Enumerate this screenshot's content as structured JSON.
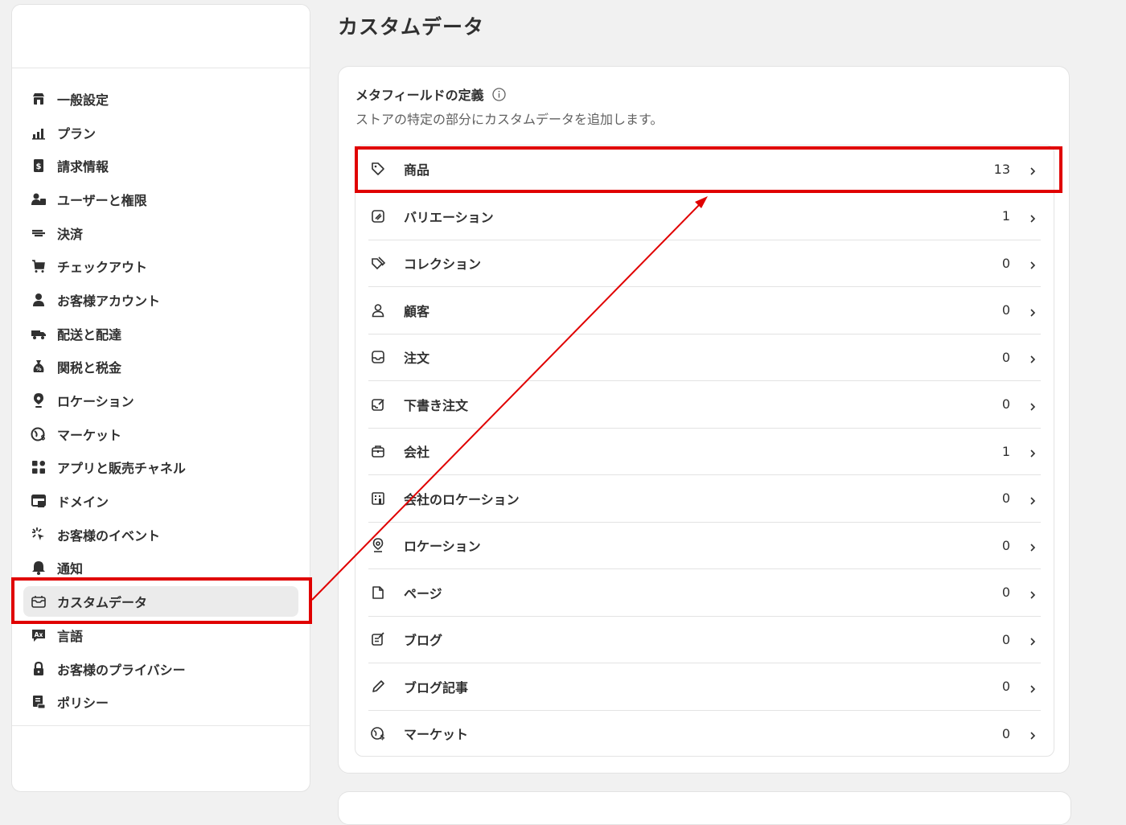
{
  "page": {
    "title": "カスタムデータ"
  },
  "sidebar": {
    "items": [
      {
        "label": "一般設定",
        "icon": "store-icon"
      },
      {
        "label": "プラン",
        "icon": "plan-chart-icon"
      },
      {
        "label": "請求情報",
        "icon": "billing-icon"
      },
      {
        "label": "ユーザーと権限",
        "icon": "users-icon"
      },
      {
        "label": "決済",
        "icon": "payments-icon"
      },
      {
        "label": "チェックアウト",
        "icon": "cart-icon"
      },
      {
        "label": "お客様アカウント",
        "icon": "person-icon"
      },
      {
        "label": "配送と配達",
        "icon": "truck-icon"
      },
      {
        "label": "関税と税金",
        "icon": "tax-bag-icon"
      },
      {
        "label": "ロケーション",
        "icon": "location-pin-icon"
      },
      {
        "label": "マーケット",
        "icon": "globe-icon"
      },
      {
        "label": "アプリと販売チャネル",
        "icon": "apps-icon"
      },
      {
        "label": "ドメイン",
        "icon": "domain-icon"
      },
      {
        "label": "お客様のイベント",
        "icon": "cursor-click-icon"
      },
      {
        "label": "通知",
        "icon": "bell-icon"
      },
      {
        "label": "カスタムデータ",
        "icon": "custom-data-icon",
        "active": true
      },
      {
        "label": "言語",
        "icon": "language-icon"
      },
      {
        "label": "お客様のプライバシー",
        "icon": "lock-icon"
      },
      {
        "label": "ポリシー",
        "icon": "policy-icon"
      }
    ]
  },
  "metafields": {
    "title": "メタフィールドの定義",
    "subtitle": "ストアの特定の部分にカスタムデータを追加します。",
    "rows": [
      {
        "label": "商品",
        "count": "13",
        "icon": "tag-icon"
      },
      {
        "label": "バリエーション",
        "count": "1",
        "icon": "variant-icon"
      },
      {
        "label": "コレクション",
        "count": "0",
        "icon": "collection-icon"
      },
      {
        "label": "顧客",
        "count": "0",
        "icon": "customer-icon"
      },
      {
        "label": "注文",
        "count": "0",
        "icon": "order-inbox-icon"
      },
      {
        "label": "下書き注文",
        "count": "0",
        "icon": "draft-order-icon"
      },
      {
        "label": "会社",
        "count": "1",
        "icon": "company-icon"
      },
      {
        "label": "会社のロケーション",
        "count": "0",
        "icon": "company-location-icon"
      },
      {
        "label": "ロケーション",
        "count": "0",
        "icon": "location-pin-icon"
      },
      {
        "label": "ページ",
        "count": "0",
        "icon": "page-icon"
      },
      {
        "label": "ブログ",
        "count": "0",
        "icon": "blog-icon"
      },
      {
        "label": "ブログ記事",
        "count": "0",
        "icon": "pencil-icon"
      },
      {
        "label": "マーケット",
        "count": "0",
        "icon": "globe-icon"
      }
    ]
  },
  "colors": {
    "highlight": "#e00000",
    "active_bg": "#ebebeb"
  }
}
